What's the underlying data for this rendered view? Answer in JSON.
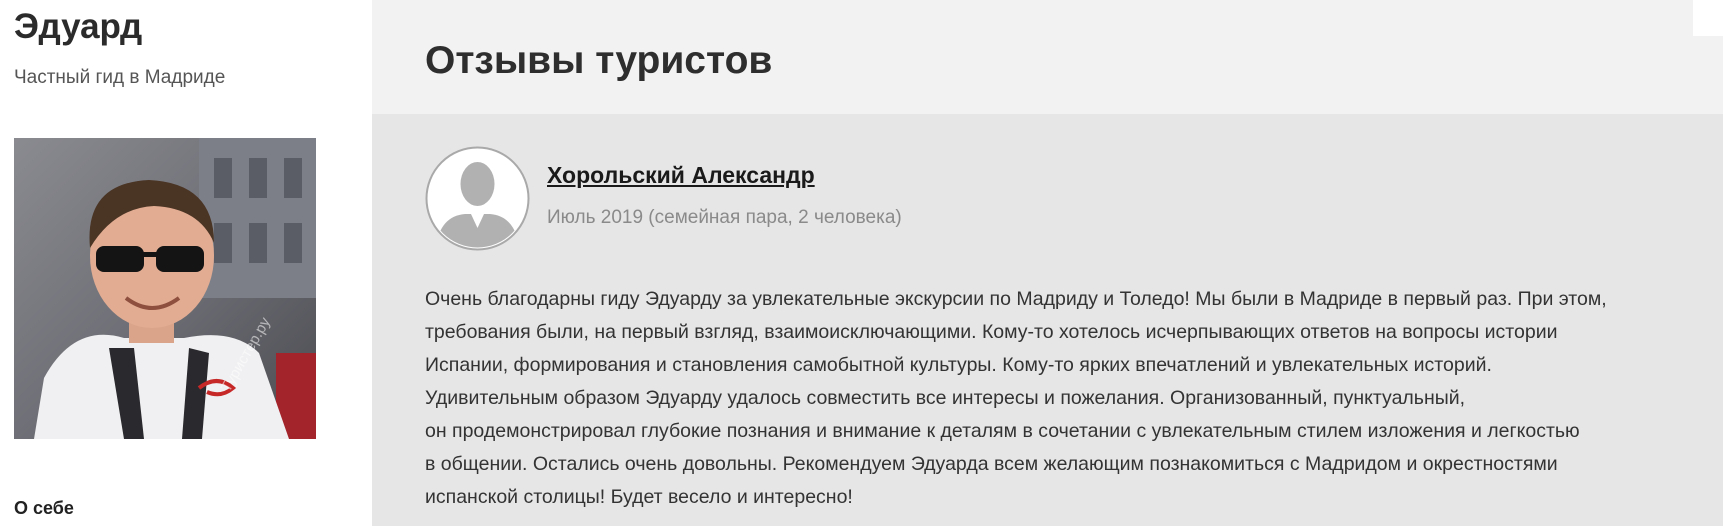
{
  "guide": {
    "name": "Эдуард",
    "subtitle": "Частный гид в Мадриде",
    "photo_watermark": "Туристер.ру",
    "about_heading": "О себе"
  },
  "reviews_section": {
    "title": "Отзывы туристов"
  },
  "review": {
    "author": "Хорольский Александр",
    "meta": "Июль 2019 (семейная пара, 2 человека)",
    "text_lines": [
      "Очень благодарны гиду Эдуарду за увлекательные экскурсии по Мадриду и Толедо! Мы были в Мадриде в первый раз. При этом,",
      "требования были, на первый взгляд, взаимоисключающими. Кому-то хотелось исчерпывающих ответов на вопросы истории",
      "Испании, формирования и становления самобытной культуры. Кому-то ярких впечатлений и увлекательных историй.",
      "Удивительным образом Эдуарду удалось совместить все интересы и пожелания. Организованный, пунктуальный,",
      "он продемонстрировал глубокие познания и внимание к деталям в сочетании с увлекательным стилем изложения и легкостью",
      "в общении. Остались очень довольны. Рекомендуем Эдуарда всем желающим познакомиться с Мадридом и окрестностями",
      "испанской столицы! Будет весело и интересно!"
    ]
  },
  "colors": {
    "main_background": "#e6e6e6",
    "header_background": "#f2f2f2",
    "text": "#333333",
    "muted_text": "#8a8a8a"
  }
}
